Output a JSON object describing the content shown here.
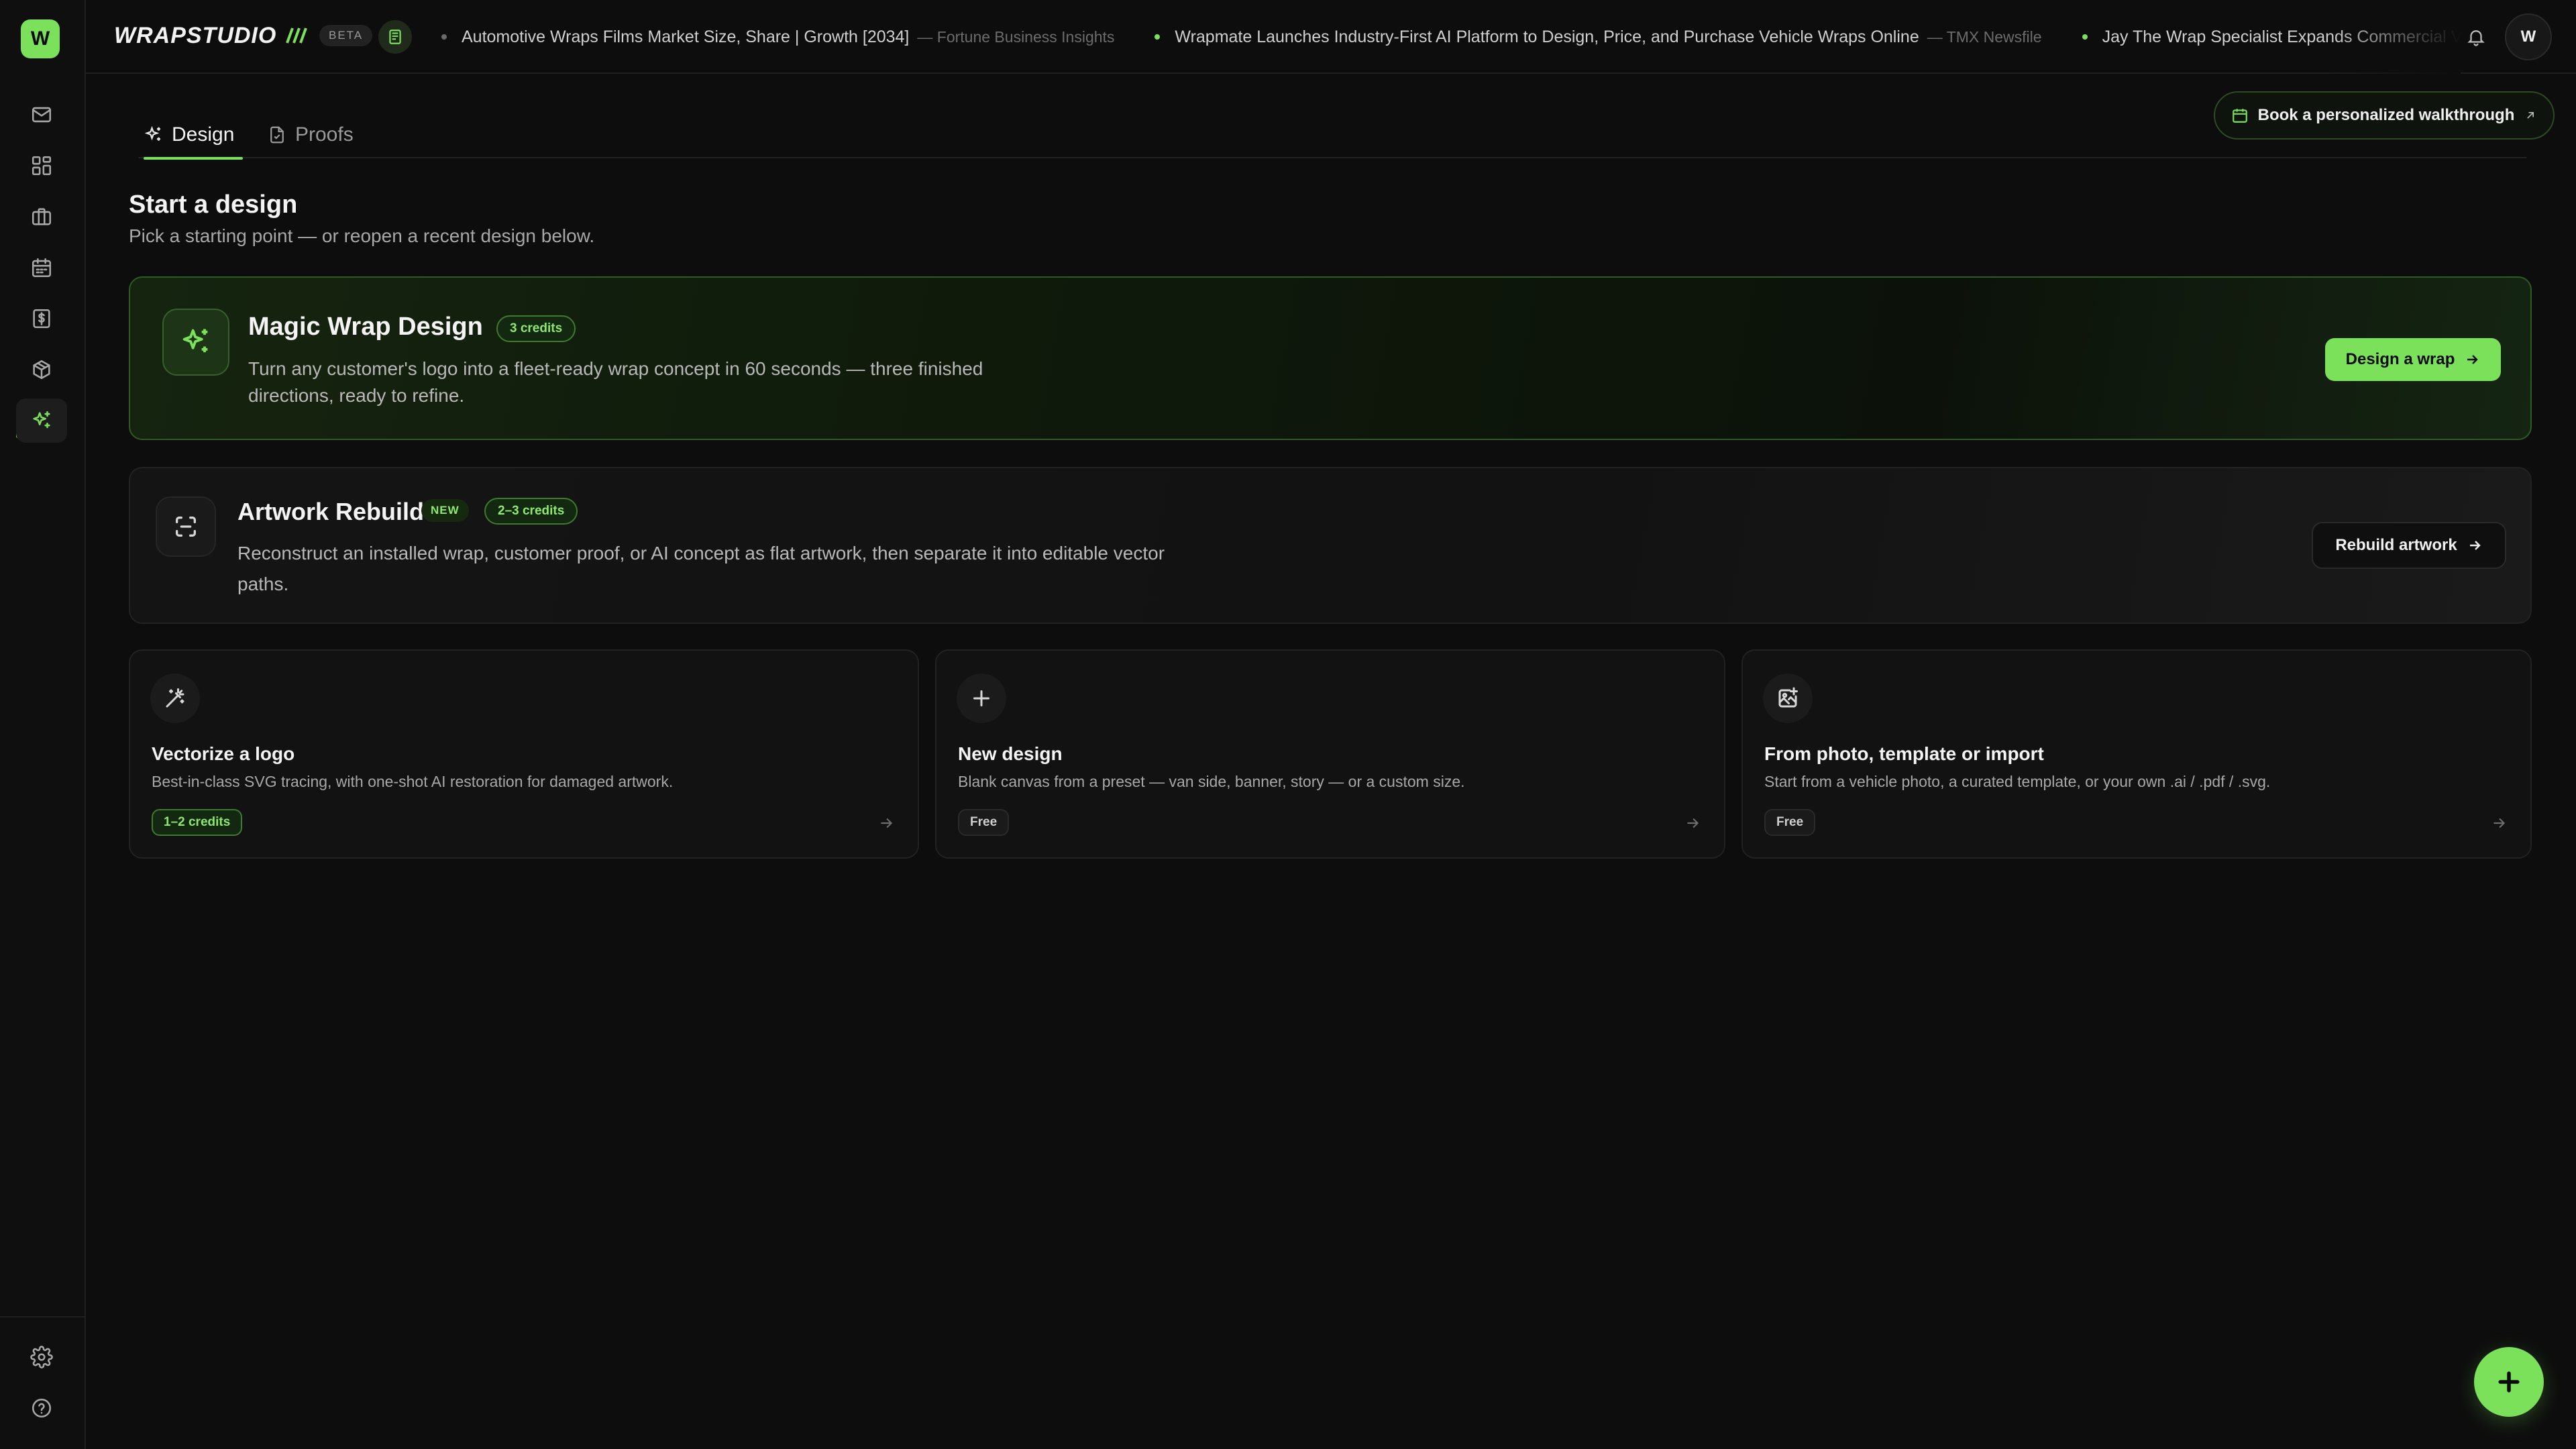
{
  "app": {
    "logo_letter": "W",
    "wordmark": "WRAPSTUDIO",
    "beta_label": "BETA",
    "accent_color": "#7be05a"
  },
  "sidebar": {
    "items": [
      {
        "name": "inbox",
        "icon": "mail-icon"
      },
      {
        "name": "dashboard",
        "icon": "grid-icon"
      },
      {
        "name": "jobs",
        "icon": "briefcase-icon"
      },
      {
        "name": "calendar",
        "icon": "calendar-icon"
      },
      {
        "name": "billing",
        "icon": "dollar-file-icon"
      },
      {
        "name": "products",
        "icon": "box-icon"
      },
      {
        "name": "design",
        "icon": "sparkles-icon",
        "active": true
      }
    ],
    "bottom_items": [
      {
        "name": "settings",
        "icon": "gear-icon"
      },
      {
        "name": "help",
        "icon": "help-circle-icon"
      }
    ]
  },
  "ticker": [
    {
      "title": "Automotive Wraps Films Market Size, Share | Growth [2034]",
      "source": "— Fortune Business Insights",
      "dot_color": "#6a6a6a"
    },
    {
      "title": "Wrapmate Launches Industry-First AI Platform to Design, Price, and Purchase Vehicle Wraps Online",
      "source": "— TMX Newsfile",
      "dot_color": "#7be05a"
    },
    {
      "title": "Jay The Wrap Specialist Expands Commercial Vehicle",
      "source": "",
      "dot_color": "#7be05a"
    }
  ],
  "header": {
    "avatar_letter": "W"
  },
  "tabs": [
    {
      "label": "Design",
      "active": true
    },
    {
      "label": "Proofs",
      "active": false
    }
  ],
  "walkthrough_label": "Book a personalized walkthrough",
  "section": {
    "title": "Start a design",
    "subtitle": "Pick a starting point — or reopen a recent design below."
  },
  "magic": {
    "title": "Magic Wrap Design",
    "credits": "3 credits",
    "description": "Turn any customer's logo into a fleet-ready wrap concept in 60 seconds — three finished directions, ready to refine.",
    "cta": "Design a wrap"
  },
  "artwork": {
    "title": "Artwork Rebuild",
    "new_badge": "NEW",
    "credits": "2–3 credits",
    "description": "Reconstruct an installed wrap, customer proof, or AI concept as flat artwork, then separate it into editable vector paths.",
    "cta": "Rebuild artwork"
  },
  "options": [
    {
      "title": "Vectorize a logo",
      "description": "Best-in-class SVG tracing, with one-shot AI restoration for damaged artwork.",
      "tag": "1–2 credits",
      "icon": "magic-wand-icon"
    },
    {
      "title": "New design",
      "description": "Blank canvas from a preset — van side, banner, story — or a custom size.",
      "tag": "Free",
      "icon": "plus-icon"
    },
    {
      "title": "From photo, template or import",
      "description": "Start from a vehicle photo, a curated template, or your own .ai / .pdf / .svg.",
      "tag": "Free",
      "icon": "image-plus-icon"
    }
  ]
}
